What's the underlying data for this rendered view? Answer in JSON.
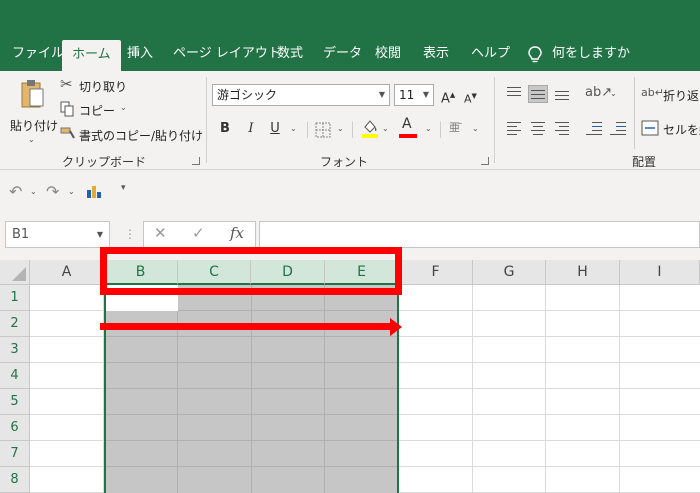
{
  "tabs": [
    "ファイル",
    "ホーム",
    "挿入",
    "ページ レイアウト",
    "数式",
    "データ",
    "校閲",
    "表示",
    "ヘルプ"
  ],
  "tell_me": "何をしますか",
  "clipboard": {
    "paste": "貼り付け",
    "cut": "切り取り",
    "copy": "コピー",
    "format_painter": "書式のコピー/貼り付け",
    "group_label": "クリップボード"
  },
  "font": {
    "name": "游ゴシック",
    "size": "11",
    "bold": "B",
    "italic": "I",
    "underline": "U",
    "font_color_glyph": "A",
    "grow": "A",
    "shrink": "A",
    "group_label": "フォント",
    "highlight_color": "#ffff00",
    "font_color": "#ff0000"
  },
  "alignment": {
    "wrap_text": "折り返し",
    "merge": "セルを結",
    "group_label": "配置"
  },
  "formula_bar": {
    "name_box": "B1",
    "fx": "fx",
    "cancel": "✕",
    "enter": "✓",
    "value": ""
  },
  "grid": {
    "columns": [
      "A",
      "B",
      "C",
      "D",
      "E",
      "F",
      "G",
      "H",
      "I"
    ],
    "rows": [
      "1",
      "2",
      "3",
      "4",
      "5",
      "6",
      "7",
      "8"
    ],
    "selected_columns": [
      "B",
      "C",
      "D",
      "E"
    ],
    "active_cell": "B1"
  },
  "colors": {
    "brand": "#217346",
    "annotation": "#ff0000",
    "selection_fill": "#c6c6c6"
  }
}
